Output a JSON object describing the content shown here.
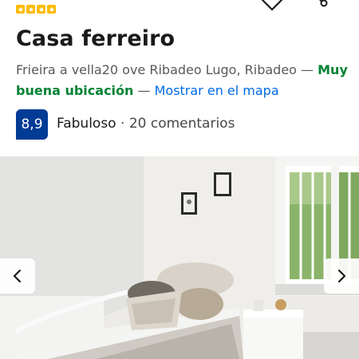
{
  "listing": {
    "stars": 4,
    "title": "Casa ferreiro",
    "address": "Frieira a vella20 ove Ribadeo Lugo, Ribadeo",
    "separator1": " — ",
    "location_rating": "Muy buena ubicación",
    "separator2": " — ",
    "map_link": "Mostrar en el mapa",
    "score": "8,9",
    "score_word": "Fabuloso",
    "score_dot": " · ",
    "reviews": "20 comentarios"
  },
  "icons": {
    "favorite": "heart-icon",
    "share": "share-icon",
    "prev": "chevron-left-icon",
    "next": "chevron-right-icon",
    "star": "star-icon"
  },
  "colors": {
    "star": "#febb02",
    "score_badge": "#003b95",
    "good_location": "#008234",
    "link": "#006ce4"
  }
}
